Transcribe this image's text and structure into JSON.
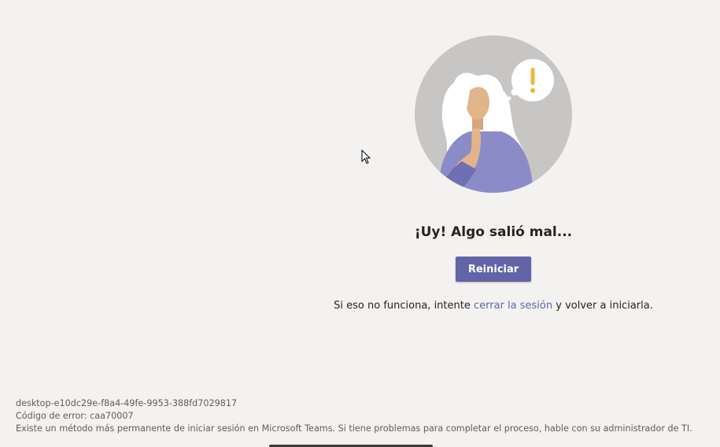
{
  "error": {
    "title": "¡Uy! Algo salió mal...",
    "restart_label": "Reiniciar",
    "hint_before": "Si eso no funciona, intente ",
    "hint_link": "cerrar la sesión",
    "hint_after": " y volver a iniciarla."
  },
  "footer": {
    "session_id": "desktop-e10dc29e-f8a4-49fe-9953-388fd7029817",
    "error_code": "Código de error: caa70007",
    "info": "Existe un método más permanente de iniciar sesión en Microsoft Teams. Si tiene problemas para completar el proceso, hable con su administrador de TI."
  },
  "colors": {
    "background": "#f3f2f1",
    "accent": "#6264a7",
    "warning": "#f2b43c"
  },
  "icons": {
    "illustration": "confused-woman-illustration",
    "exclamation": "exclamation-icon",
    "cursor": "mouse-cursor-icon"
  }
}
